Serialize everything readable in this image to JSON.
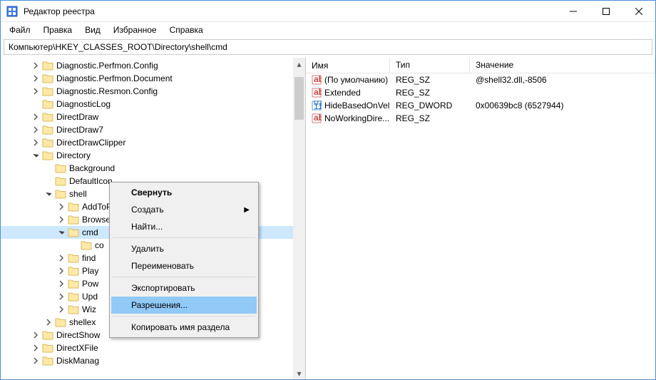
{
  "window": {
    "title": "Редактор реестра"
  },
  "menubar": [
    "Файл",
    "Правка",
    "Вид",
    "Избранное",
    "Справка"
  ],
  "address": "Компьютер\\HKEY_CLASSES_ROOT\\Directory\\shell\\cmd",
  "tree": [
    {
      "indent": 2,
      "exp": "closed",
      "label": "Diagnostic.Perfmon.Config"
    },
    {
      "indent": 2,
      "exp": "closed",
      "label": "Diagnostic.Perfmon.Document"
    },
    {
      "indent": 2,
      "exp": "closed",
      "label": "Diagnostic.Resmon.Config"
    },
    {
      "indent": 2,
      "exp": "none",
      "label": "DiagnosticLog"
    },
    {
      "indent": 2,
      "exp": "closed",
      "label": "DirectDraw"
    },
    {
      "indent": 2,
      "exp": "closed",
      "label": "DirectDraw7"
    },
    {
      "indent": 2,
      "exp": "closed",
      "label": "DirectDrawClipper"
    },
    {
      "indent": 2,
      "exp": "open",
      "label": "Directory"
    },
    {
      "indent": 3,
      "exp": "none",
      "label": "Background"
    },
    {
      "indent": 3,
      "exp": "none",
      "label": "DefaultIcon"
    },
    {
      "indent": 3,
      "exp": "open",
      "label": "shell"
    },
    {
      "indent": 4,
      "exp": "closed",
      "label": "AddToPlaylistVLC"
    },
    {
      "indent": 4,
      "exp": "closed",
      "label": "Browse with &IrfanView"
    },
    {
      "indent": 4,
      "exp": "open",
      "label": "cmd",
      "selected": true
    },
    {
      "indent": 5,
      "exp": "none",
      "label": "co"
    },
    {
      "indent": 4,
      "exp": "closed",
      "label": "find"
    },
    {
      "indent": 4,
      "exp": "closed",
      "label": "Play"
    },
    {
      "indent": 4,
      "exp": "closed",
      "label": "Pow"
    },
    {
      "indent": 4,
      "exp": "closed",
      "label": "Upd"
    },
    {
      "indent": 4,
      "exp": "closed",
      "label": "Wiz"
    },
    {
      "indent": 3,
      "exp": "closed",
      "label": "shellex"
    },
    {
      "indent": 2,
      "exp": "closed",
      "label": "DirectShow"
    },
    {
      "indent": 2,
      "exp": "closed",
      "label": "DirectXFile"
    },
    {
      "indent": 2,
      "exp": "closed",
      "label": "DiskManag"
    }
  ],
  "list": {
    "headers": {
      "name": "Имя",
      "type": "Тип",
      "value": "Значение"
    },
    "rows": [
      {
        "icon": "ab",
        "name": "(По умолчанию)",
        "type": "REG_SZ",
        "value": "@shell32.dll,-8506"
      },
      {
        "icon": "ab",
        "name": "Extended",
        "type": "REG_SZ",
        "value": ""
      },
      {
        "icon": "bin",
        "name": "HideBasedOnVel...",
        "type": "REG_DWORD",
        "value": "0x00639bc8 (6527944)"
      },
      {
        "icon": "ab",
        "name": "NoWorkingDire...",
        "type": "REG_SZ",
        "value": ""
      }
    ]
  },
  "context_menu": {
    "items": [
      {
        "label": "Свернуть",
        "bold": true
      },
      {
        "label": "Создать",
        "submenu": true
      },
      {
        "label": "Найти..."
      },
      {
        "sep": true
      },
      {
        "label": "Удалить"
      },
      {
        "label": "Переименовать"
      },
      {
        "sep": true
      },
      {
        "label": "Экспортировать"
      },
      {
        "label": "Разрешения...",
        "highlighted": true
      },
      {
        "sep": true
      },
      {
        "label": "Копировать имя раздела"
      }
    ]
  }
}
